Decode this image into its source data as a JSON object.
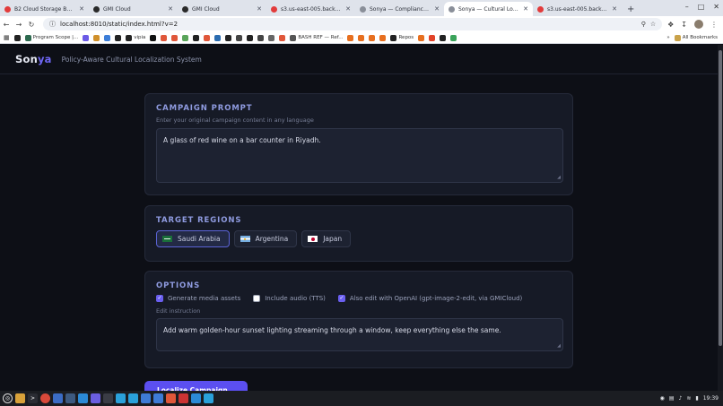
{
  "browser": {
    "tabs": [
      {
        "title": "B2 Cloud Storage Buckets",
        "color": "#e23b3b"
      },
      {
        "title": "GMI Cloud",
        "color": "#2a2a2a"
      },
      {
        "title": "GMI Cloud",
        "color": "#2a2a2a"
      },
      {
        "title": "s3.us-east-005.backblaze...",
        "color": "#e23b3b"
      },
      {
        "title": "Sonya — Compliance Notary",
        "color": "#8a8f99"
      },
      {
        "title": "Sonya — Cultural Localiza...",
        "color": "#8a8f99"
      },
      {
        "title": "s3.us-east-005.backblaze...",
        "color": "#e23b3b"
      }
    ],
    "url": "localhost:8010/static/index.html?v=2",
    "bookmarks": [
      {
        "label": "",
        "color": "#222"
      },
      {
        "label": "Program Scope |...",
        "color": "#2d6a4f"
      },
      {
        "label": "",
        "color": "#6b5ae6"
      },
      {
        "label": "",
        "color": "#d0902a"
      },
      {
        "label": "",
        "color": "#3d7ed8"
      },
      {
        "label": "",
        "color": "#222"
      },
      {
        "label": "vipia",
        "color": "#222"
      },
      {
        "label": "",
        "color": "#111"
      },
      {
        "label": "",
        "color": "#e0573a"
      },
      {
        "label": "",
        "color": "#e0573a"
      },
      {
        "label": "",
        "color": "#5aa55a"
      },
      {
        "label": "",
        "color": "#222"
      },
      {
        "label": "",
        "color": "#e0573a"
      },
      {
        "label": "",
        "color": "#2b6cb0"
      },
      {
        "label": "",
        "color": "#222"
      },
      {
        "label": "",
        "color": "#444"
      },
      {
        "label": "",
        "color": "#222"
      },
      {
        "label": "",
        "color": "#444"
      },
      {
        "label": "",
        "color": "#666"
      },
      {
        "label": "",
        "color": "#e0573a"
      },
      {
        "label": "BASH REF — Ref...",
        "color": "#555"
      },
      {
        "label": "",
        "color": "#e76f1f"
      },
      {
        "label": "",
        "color": "#e76f1f"
      },
      {
        "label": "",
        "color": "#e76f1f"
      },
      {
        "label": "",
        "color": "#e76f1f"
      },
      {
        "label": "Repos",
        "color": "#222"
      },
      {
        "label": "",
        "color": "#e76f1f"
      },
      {
        "label": "",
        "color": "#e24329"
      },
      {
        "label": "",
        "color": "#222"
      },
      {
        "label": "",
        "color": "#3aa35a"
      }
    ],
    "all_bookmarks": "All Bookmarks"
  },
  "app": {
    "brand_main": "Son",
    "brand_accent": "ya",
    "tagline": "Policy-Aware Cultural Localization System"
  },
  "campaign": {
    "title": "CAMPAIGN PROMPT",
    "subtitle": "Enter your original campaign content in any language",
    "value": "A glass of red wine on a bar counter in Riyadh."
  },
  "regions": {
    "title": "TARGET REGIONS",
    "items": [
      {
        "label": "Saudi Arabia",
        "flag": "sa",
        "selected": true
      },
      {
        "label": "Argentina",
        "flag": "ar",
        "selected": false
      },
      {
        "label": "Japan",
        "flag": "jp",
        "selected": false
      }
    ]
  },
  "options": {
    "title": "OPTIONS",
    "items": [
      {
        "label": "Generate media assets",
        "checked": true
      },
      {
        "label": "Include audio (TTS)",
        "checked": false
      },
      {
        "label": "Also edit with OpenAI (gpt-image-2-edit, via GMICloud)",
        "checked": true
      }
    ],
    "edit_label": "Edit instruction",
    "edit_value": "Add warm golden-hour sunset lighting streaming through a window, keep everything else the same."
  },
  "cta": {
    "label": "Localize Campaign"
  },
  "taskbar": {
    "time": "19:39"
  }
}
